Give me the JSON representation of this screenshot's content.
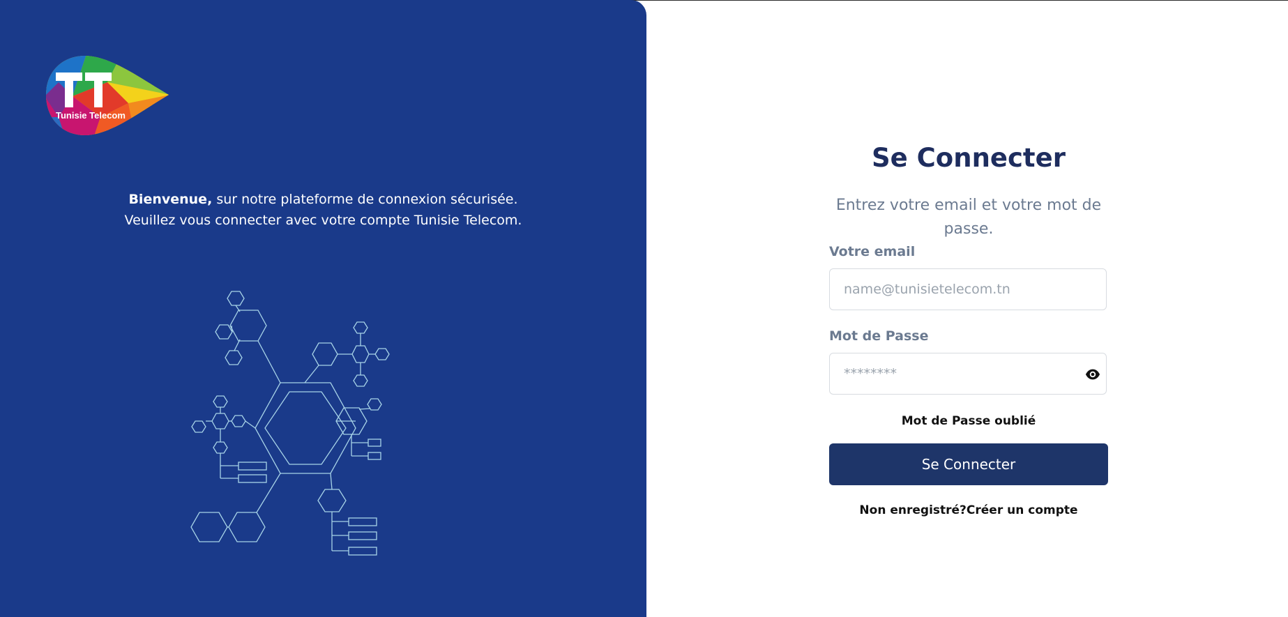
{
  "brand": {
    "logo_text": "Tunisie Telecom",
    "logo_initials": "TT",
    "panel_color": "#1a3a8a"
  },
  "welcome": {
    "bold": "Bienvenue,",
    "line1_rest": " sur notre plateforme de connexion sécurisée.",
    "line2": "Veuillez vous connecter avec votre compte Tunisie Telecom."
  },
  "login": {
    "title": "Se Connecter",
    "subtitle": "Entrez votre email et votre mot de passe.",
    "email_label": "Votre email",
    "email_placeholder": "name@tunisietelecom.tn",
    "password_label": "Mot de Passe",
    "password_placeholder": "********",
    "forgot": "Mot de Passe oublié",
    "submit": "Se Connecter",
    "register": "Non enregistré?Créer un compte",
    "button_color": "#1e3569"
  }
}
